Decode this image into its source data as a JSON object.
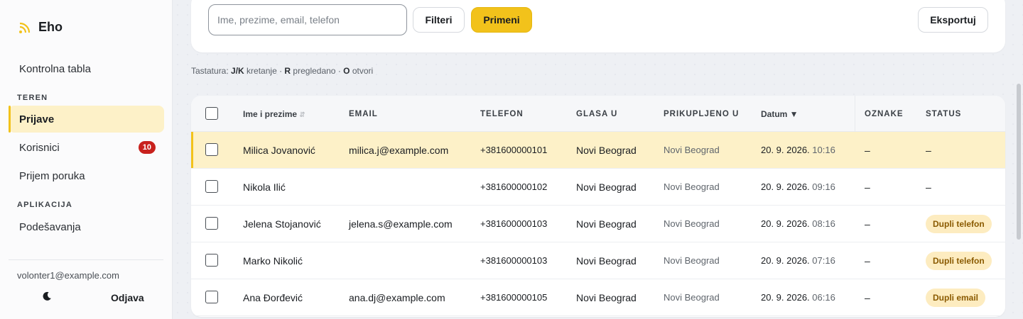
{
  "brand": {
    "name": "Eho",
    "icon": "rss-icon",
    "accent": "#f2c21b"
  },
  "sidebar": {
    "dashboard": "Kontrolna tabla",
    "section_teren": "TEREN",
    "items_teren": [
      {
        "label": "Prijave",
        "active": true
      },
      {
        "label": "Korisnici",
        "badge": "10"
      },
      {
        "label": "Prijem poruka"
      }
    ],
    "section_app": "APLIKACIJA",
    "settings": "Podešavanja",
    "user_email": "volonter1@example.com",
    "theme_icon": "moon-icon",
    "logout": "Odjava"
  },
  "toolbar": {
    "search_placeholder": "Ime, prezime, email, telefon",
    "filters": "Filteri",
    "apply": "Primeni",
    "export": "Eksportuj"
  },
  "hint": {
    "prefix": "Tastatura: ",
    "k1": "J/K",
    "t1": " kretanje · ",
    "k2": "R",
    "t2": " pregledano · ",
    "k3": "O",
    "t3": " otvori"
  },
  "table": {
    "columns": {
      "name": "Ime i prezime",
      "email": "EMAIL",
      "phone": "TELEFON",
      "votes_in": "GLASA U",
      "collected_in": "PRIKUPLJENO U",
      "date": "Datum ▼",
      "tags": "OZNAKE",
      "status": "STATUS"
    },
    "rows": [
      {
        "name": "Milica Jovanović",
        "email": "milica.j@example.com",
        "phone": "+381600000101",
        "votes_in": "Novi Beograd",
        "collected_in": "Novi Beograd",
        "date": "20. 9. 2026.",
        "time": "10:16",
        "tags": "–",
        "status": "–",
        "selected": true
      },
      {
        "name": "Nikola Ilić",
        "email": "",
        "phone": "+381600000102",
        "votes_in": "Novi Beograd",
        "collected_in": "Novi Beograd",
        "date": "20. 9. 2026.",
        "time": "09:16",
        "tags": "–",
        "status": "–"
      },
      {
        "name": "Jelena Stojanović",
        "email": "jelena.s@example.com",
        "phone": "+381600000103",
        "votes_in": "Novi Beograd",
        "collected_in": "Novi Beograd",
        "date": "20. 9. 2026.",
        "time": "08:16",
        "tags": "–",
        "status_badge": "Dupli telefon"
      },
      {
        "name": "Marko Nikolić",
        "email": "",
        "phone": "+381600000103",
        "votes_in": "Novi Beograd",
        "collected_in": "Novi Beograd",
        "date": "20. 9. 2026.",
        "time": "07:16",
        "tags": "–",
        "status_badge": "Dupli telefon"
      },
      {
        "name": "Ana Đorđević",
        "email": "ana.dj@example.com",
        "phone": "+381600000105",
        "votes_in": "Novi Beograd",
        "collected_in": "Novi Beograd",
        "date": "20. 9. 2026.",
        "time": "06:16",
        "tags": "–",
        "status_badge": "Dupli email"
      }
    ]
  }
}
